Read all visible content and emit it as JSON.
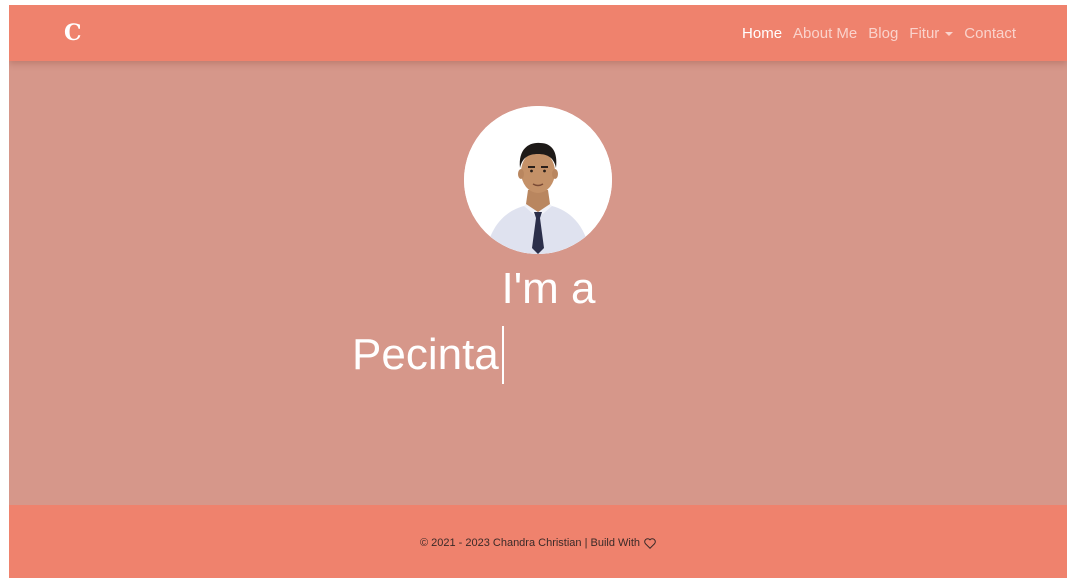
{
  "navbar": {
    "brand": "C",
    "links": {
      "home": "Home",
      "about": "About Me",
      "blog": "Blog",
      "fitur": "Fitur",
      "contact": "Contact"
    }
  },
  "hero": {
    "line1": "I'm a",
    "typed_text": "Pecinta"
  },
  "footer": {
    "text": "© 2021 - 2023 Chandra Christian | Build With"
  },
  "icons": {
    "dropdown": "caret-down-icon",
    "footer": "heart-icon"
  },
  "colors": {
    "primary": "#ef826d",
    "background": "#d6978a",
    "text_light": "#ffffff"
  }
}
